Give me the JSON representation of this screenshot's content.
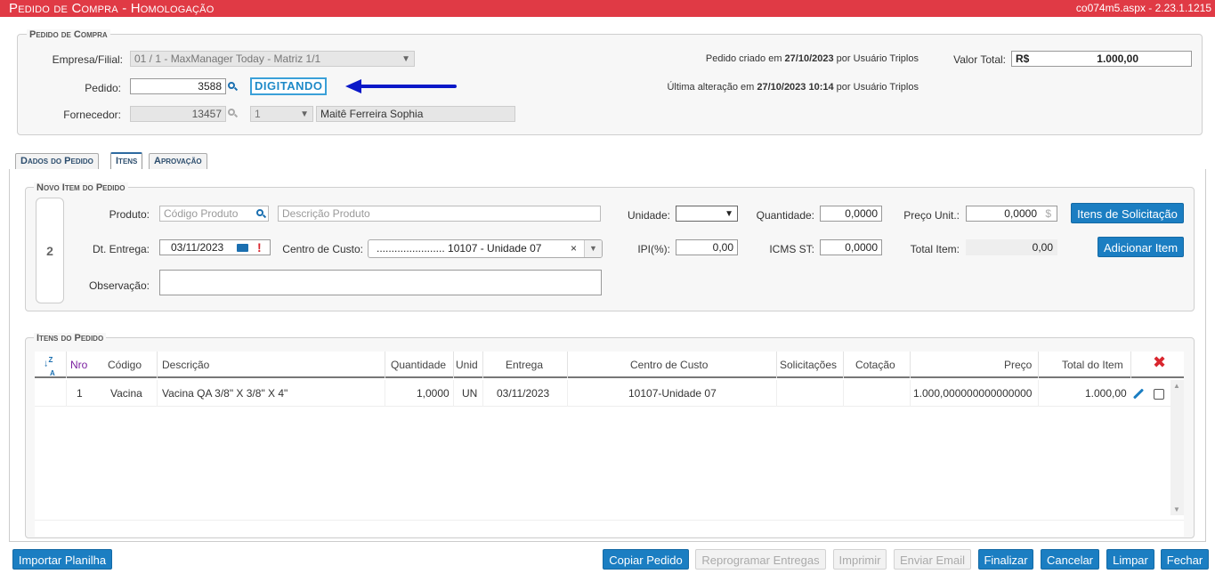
{
  "header": {
    "title": "Pedido de Compra  - Homologação",
    "version": "co074m5.aspx - 2.23.1.1215"
  },
  "pedido": {
    "legend": "Pedido de Compra",
    "empresa_label": "Empresa/Filial:",
    "empresa_value": "01 / 1 - MaxManager Today - Matriz 1/1",
    "pedido_label": "Pedido:",
    "pedido_value": "3588",
    "status": "DIGITANDO",
    "fornecedor_label": "Fornecedor:",
    "fornecedor_code": "13457",
    "fornecedor_seq": "1",
    "fornecedor_name": "Maitê Ferreira Sophia",
    "created_prefix": "Pedido criado em",
    "created_date": "27/10/2023",
    "created_suffix": "por Usuário Triplos",
    "altered_prefix": "Última alteração em",
    "altered_date": "27/10/2023 10:14",
    "altered_suffix": "por Usuário Triplos",
    "valor_label": "Valor Total:",
    "valor_currency": "R$",
    "valor_value": "1.000,00"
  },
  "tabs": [
    {
      "label": "Dados do Pedido"
    },
    {
      "label": "Itens"
    },
    {
      "label": "Aprovação"
    }
  ],
  "novo_item": {
    "legend": "Novo Item do Pedido",
    "seq": "2",
    "produto_label": "Produto:",
    "produto_placeholder": "Código Produto",
    "descricao_placeholder": "Descrição Produto",
    "unidade_label": "Unidade:",
    "quantidade_label": "Quantidade:",
    "quantidade_value": "0,0000",
    "preco_label": "Preço Unit.:",
    "preco_value": "0,0000",
    "preco_currency": "$",
    "dt_label": "Dt. Entrega:",
    "dt_value": "03/11/2023",
    "centro_label": "Centro de Custo:",
    "centro_value": "....................... 10107 - Unidade 07",
    "ipi_label": "IPI(%):",
    "ipi_value": "0,00",
    "icms_label": "ICMS ST:",
    "icms_value": "0,0000",
    "total_label": "Total Item:",
    "total_value": "0,00",
    "obs_label": "Observação:",
    "btn_solicitacao": "Itens de Solicitação",
    "btn_adicionar": "Adicionar Item"
  },
  "itens": {
    "legend": "Itens do Pedido",
    "columns": {
      "nro": "Nro",
      "codigo": "Código",
      "descricao": "Descrição",
      "quantidade": "Quantidade",
      "unid": "Unid",
      "entrega": "Entrega",
      "centro": "Centro de Custo",
      "solicitacoes": "Solicitações",
      "cotacao": "Cotação",
      "preco": "Preço",
      "total": "Total do Item"
    },
    "rows": [
      {
        "nro": "1",
        "codigo": "Vacina",
        "descricao": "Vacina QA 3/8\" X 3/8\" X 4\"",
        "quantidade": "1,0000",
        "unid": "UN",
        "entrega": "03/11/2023",
        "centro": "10107-Unidade 07",
        "solicitacoes": "",
        "cotacao": "",
        "preco": "1.000,000000000000000",
        "total": "1.000,00"
      }
    ]
  },
  "footer": {
    "importar": "Importar Planilha",
    "copiar": "Copiar Pedido",
    "reprogramar": "Reprogramar Entregas",
    "imprimir": "Imprimir",
    "enviar": "Enviar Email",
    "finalizar": "Finalizar",
    "cancelar": "Cancelar",
    "limpar": "Limpar",
    "fechar": "Fechar"
  },
  "colors": {
    "title_bar": "#e03a45",
    "primary_button": "#1b7ec2",
    "status_border": "#3aa0d8",
    "arrow": "#0a18c8"
  }
}
